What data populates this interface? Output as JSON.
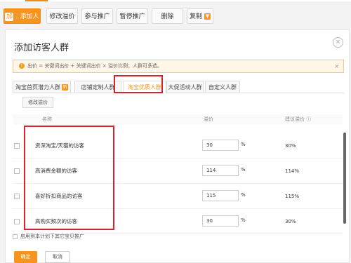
{
  "toolbar": {
    "add_prefix": "加",
    "add_label": "添加人群",
    "buttons": [
      "修改溢价",
      "参与推广",
      "暂停推广",
      "删除"
    ],
    "copy_label": "复制",
    "copy_icon": "chevron-down-icon"
  },
  "dialog": {
    "title": "添加访客人群",
    "close_icon": "close-circle-icon",
    "alert": {
      "icon": "info-icon",
      "text": "出价 = 关键词出价 + 关键词出价 × 溢价比例；人群可多选。",
      "close": "×"
    },
    "tabs": [
      {
        "label": "淘宝首页潜力人群",
        "badge": "新"
      },
      {
        "label": "店铺定制人群"
      },
      {
        "label": "淘宝优质人群",
        "active": true
      },
      {
        "label": "大促活动人群"
      },
      {
        "label": "自定义人群"
      }
    ],
    "sub_button": "修改溢价",
    "table": {
      "headers": {
        "name": "名称",
        "bid": "溢价",
        "suggest": "建议溢价 ⓘ"
      },
      "rows": [
        {
          "name": "资深淘宝/天猫的访客",
          "bid": "30",
          "pct": "%",
          "suggest": "30%"
        },
        {
          "name": "高消费金额的访客",
          "bid": "114",
          "pct": "%",
          "suggest": "114%"
        },
        {
          "name": "喜好折扣商品的访客",
          "bid": "115",
          "pct": "%",
          "suggest": "115%"
        },
        {
          "name": "高购买频次的访客",
          "bid": "30",
          "pct": "%",
          "suggest": "30%"
        }
      ]
    },
    "apply_label": "启用到本计划下其它宝贝推广",
    "ok_label": "确定",
    "cancel_label": "取消"
  },
  "colors": {
    "accent": "#f7941d",
    "highlight": "#d9232c"
  }
}
